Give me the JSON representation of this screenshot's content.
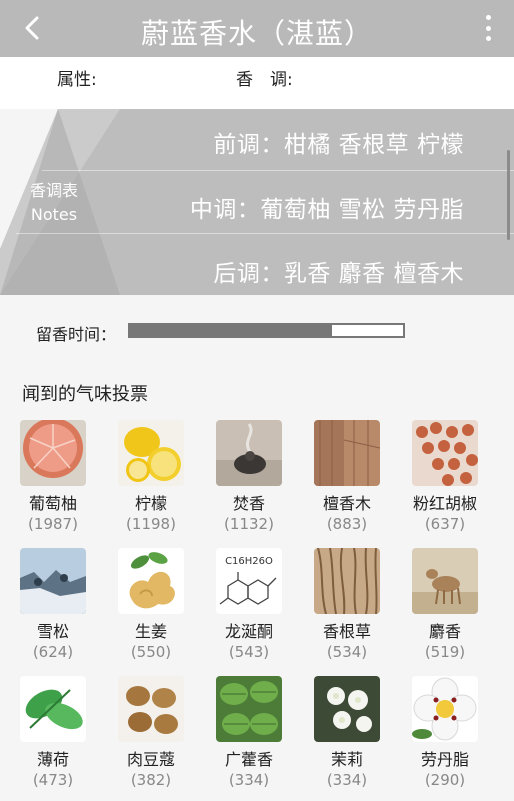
{
  "header": {
    "title": "蔚蓝香水（湛蓝）"
  },
  "attributes": {
    "attr_label": "属性:",
    "note_label": "香　调:"
  },
  "notes": {
    "side_zh": "香调表",
    "side_en": "Notes",
    "top": "前调：柑橘  香根草 柠檬",
    "middle": "中调：葡萄柚  雪松 劳丹脂",
    "base": "后调：乳香  麝香  檀香木"
  },
  "longevity": {
    "label": "留香时间：",
    "level": 0.74
  },
  "votes": {
    "title": "闻到的气味投票",
    "items": [
      {
        "name": "葡萄柚",
        "count": "(1987)",
        "icon": "grapefruit-icon"
      },
      {
        "name": "柠檬",
        "count": "(1198)",
        "icon": "lemon-icon"
      },
      {
        "name": "焚香",
        "count": "(1132)",
        "icon": "incense-icon"
      },
      {
        "name": "檀香木",
        "count": "(883)",
        "icon": "sandalwood-icon"
      },
      {
        "name": "粉红胡椒",
        "count": "(637)",
        "icon": "pink-pepper-icon"
      },
      {
        "name": "雪松",
        "count": "(624)",
        "icon": "cedar-icon"
      },
      {
        "name": "生姜",
        "count": "(550)",
        "icon": "ginger-icon"
      },
      {
        "name": "龙涎酮",
        "count": "(543)",
        "icon": "ambroxan-icon",
        "formula": "C16H26O"
      },
      {
        "name": "香根草",
        "count": "(534)",
        "icon": "vetiver-icon"
      },
      {
        "name": "麝香",
        "count": "(519)",
        "icon": "musk-deer-icon"
      },
      {
        "name": "薄荷",
        "count": "(473)",
        "icon": "mint-icon"
      },
      {
        "name": "肉豆蔻",
        "count": "(382)",
        "icon": "nutmeg-icon"
      },
      {
        "name": "广藿香",
        "count": "(334)",
        "icon": "patchouli-icon"
      },
      {
        "name": "茉莉",
        "count": "(334)",
        "icon": "jasmine-icon"
      },
      {
        "name": "劳丹脂",
        "count": "(290)",
        "icon": "labdanum-icon"
      }
    ]
  },
  "colors": {
    "header": "#b9b9b9",
    "notes_panel": "#bdbdbd",
    "bar": "#777777"
  }
}
